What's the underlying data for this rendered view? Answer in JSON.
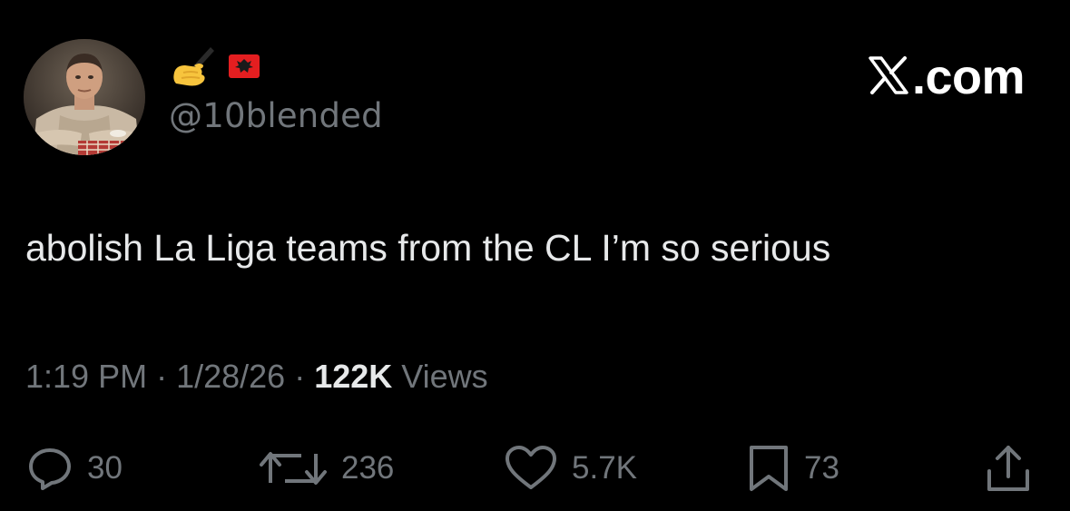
{
  "author": {
    "display_name_emojis": [
      "writing-hand-emoji",
      "albania-flag-emoji"
    ],
    "handle": "@10blended",
    "avatar": "profile-photo"
  },
  "watermark": {
    "text": ".com",
    "logo": "x-logo-icon"
  },
  "tweet": {
    "text": "abolish La Liga teams from the CL I’m so serious"
  },
  "meta": {
    "time": "1:19 PM",
    "separator": " · ",
    "date": "1/28/26",
    "views_count": "122K",
    "views_label": " Views"
  },
  "actions": {
    "replies": "30",
    "reposts": "236",
    "likes": "5.7K",
    "bookmarks": "73",
    "reply_icon": "reply-icon",
    "repost_icon": "repost-icon",
    "like_icon": "heart-icon",
    "bookmark_icon": "bookmark-icon",
    "share_icon": "share-icon"
  },
  "colors": {
    "background": "#000000",
    "primary_text": "#e7e9ea",
    "secondary_text": "#71767b"
  }
}
